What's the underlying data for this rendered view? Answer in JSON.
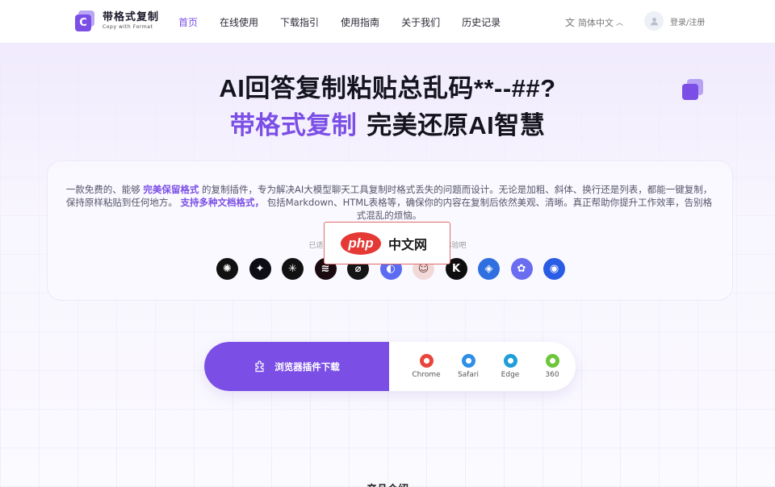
{
  "header": {
    "logo_title": "带格式复制",
    "logo_subtitle": "Copy with Format",
    "logo_letter": "C",
    "nav": [
      "首页",
      "在线使用",
      "下载指引",
      "使用指南",
      "关于我们",
      "历史记录"
    ],
    "active_nav": "首页",
    "language": "简体中文",
    "login_label": "登录/注册"
  },
  "hero": {
    "line1": "AI回答复制粘贴总乱码**--##?",
    "highlight": "带格式复制",
    "rest": "完美还原AI智慧"
  },
  "description": {
    "part1": "一款免费的、能够",
    "em1": "完美保留格式",
    "part2": "的复制插件，专为解决AI大模型聊天工具复制时格式丢失的问题而设计。无论是加粗、斜体、换行还是列表，都能一键复制，保持原样粘贴到任何地方。",
    "em2": "支持多种文档格式，",
    "part3": "包括Markdown、HTML表格等，确保你的内容在复制后依然美观、清晰。真正帮助你提升工作效率，告别格式混乱的烦恼。"
  },
  "support_line": {
    "left": "已适",
    "right": "体验吧"
  },
  "ai_icons": [
    {
      "name": "chatgpt-icon",
      "bg": "#111111",
      "glyph": "✺"
    },
    {
      "name": "gemini-icon",
      "bg": "#0d0d16",
      "glyph": "✦"
    },
    {
      "name": "claude-icon",
      "bg": "#111111",
      "glyph": "✳"
    },
    {
      "name": "doubao-icon",
      "bg": "#1a0a10",
      "glyph": "≋"
    },
    {
      "name": "perplexity-icon",
      "bg": "#151515",
      "glyph": "⌀"
    },
    {
      "name": "copilot-icon",
      "bg": "#5b6cf2",
      "glyph": "◐"
    },
    {
      "name": "character-avatar-icon",
      "bg": "#f2d9d9",
      "glyph": "☺"
    },
    {
      "name": "kimi-icon",
      "bg": "#0e0e0e",
      "glyph": "K"
    },
    {
      "name": "qwen-icon",
      "bg": "#2f6fe0",
      "glyph": "◈"
    },
    {
      "name": "wenxin-icon",
      "bg": "#6a6df0",
      "glyph": "✿"
    },
    {
      "name": "deepseek-icon",
      "bg": "#2a5de6",
      "glyph": "◉"
    }
  ],
  "watermark": {
    "logo": "php",
    "text": "中文网"
  },
  "download": {
    "button_label": "浏览器插件下载",
    "browsers": [
      {
        "name": "Chrome",
        "color": "#e8453c"
      },
      {
        "name": "Safari",
        "color": "#2e8fe8"
      },
      {
        "name": "Edge",
        "color": "#1f9ed8"
      },
      {
        "name": "360",
        "color": "#6cc63a"
      }
    ]
  },
  "bottom_heading": "产品介绍"
}
